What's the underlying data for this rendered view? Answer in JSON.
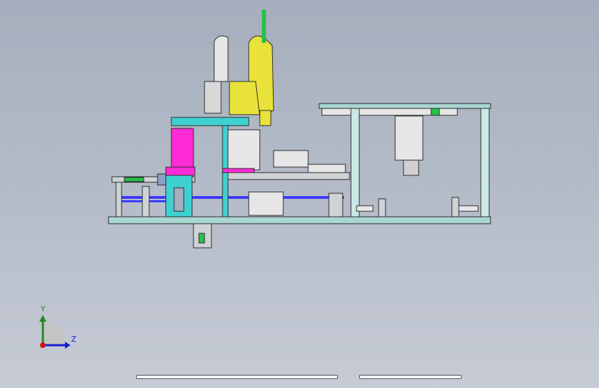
{
  "view": {
    "background_top": "#a6aebd",
    "background_bottom": "#c6cbd5"
  },
  "triad": {
    "y_label": "Y",
    "z_label": "Z",
    "y_color": "#1f8a1f",
    "z_color": "#1b1bd6",
    "origin_color": "#d01414"
  },
  "model_colors": {
    "frame": "#a9d6d2",
    "robot": "#e8e23a",
    "cyan_part": "#3fd1d1",
    "magenta_part": "#ff2bd6",
    "blue_rail": "#3a3aff",
    "green_part": "#27c24a",
    "dark_line": "#2a2a2a",
    "gray_part": "#cfd3d6"
  }
}
